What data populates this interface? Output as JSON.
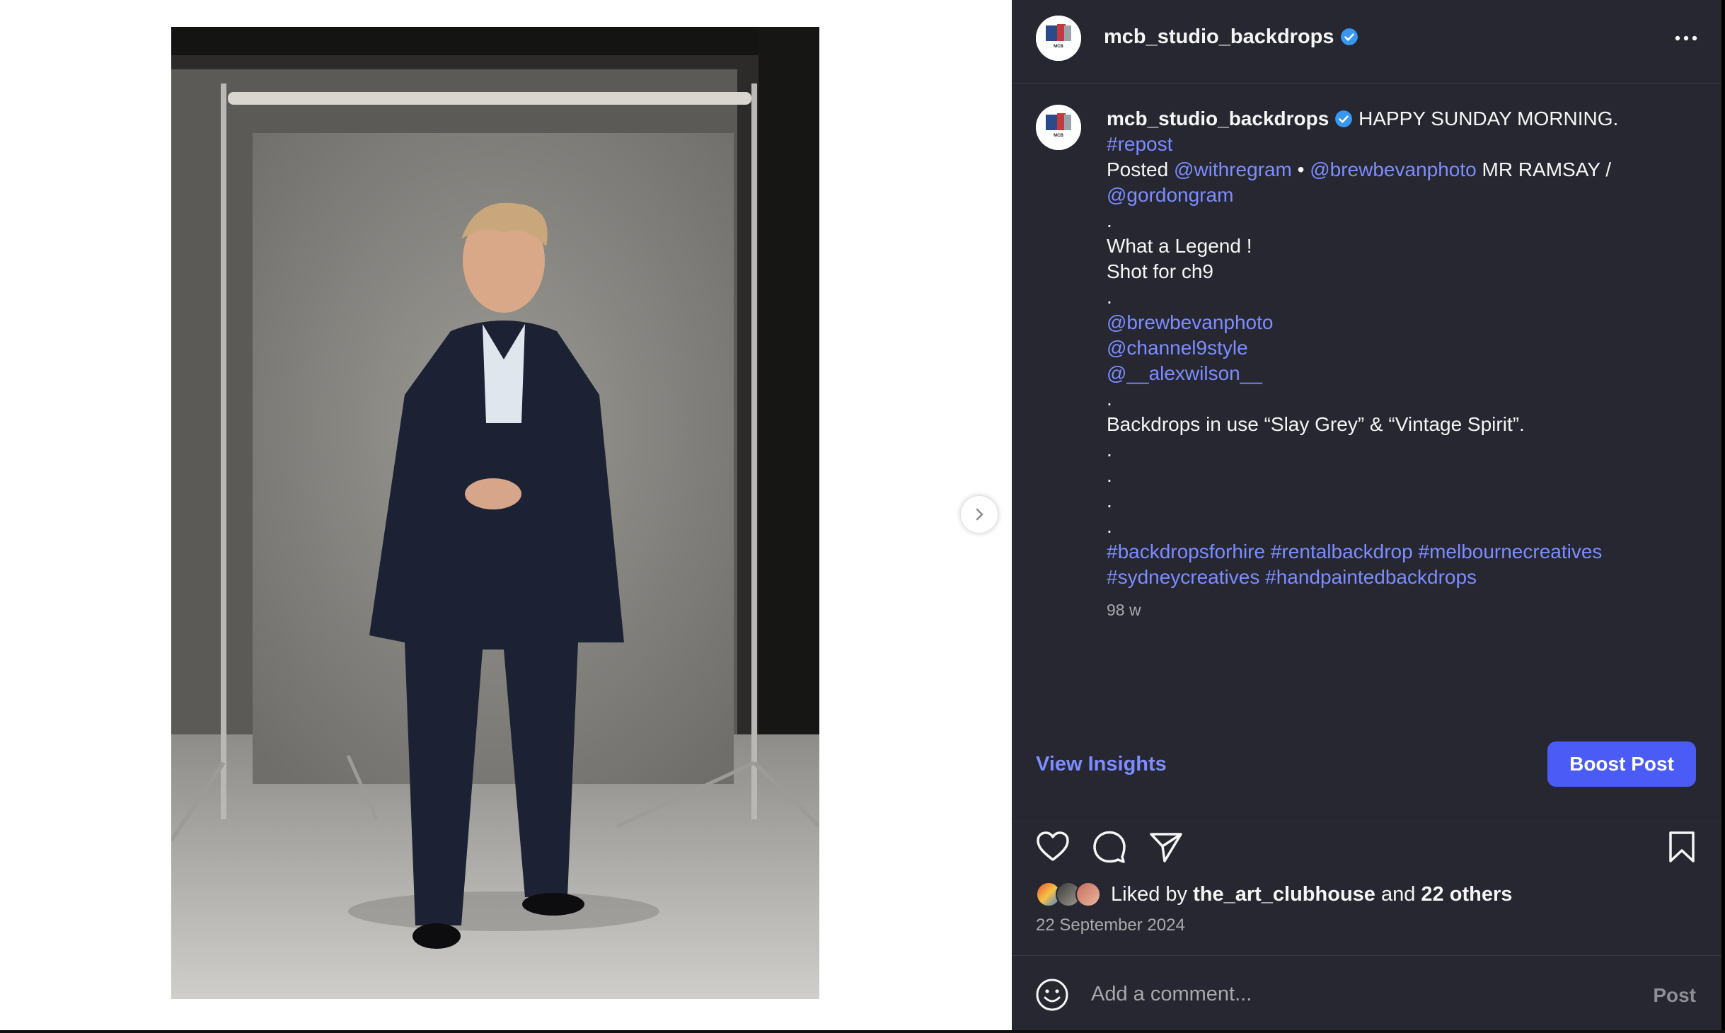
{
  "post": {
    "username": "mcb_studio_backdrops",
    "avatar_label": "MCB",
    "photo_alt": "Man in a dark checked suit standing in front of a grey painted studio backdrop",
    "caption_lines": [
      {
        "parts": [
          {
            "t": "HAPPY SUNDAY MORNING.",
            "link": false
          }
        ]
      },
      {
        "parts": [
          {
            "t": "#repost",
            "link": true
          }
        ]
      },
      {
        "parts": [
          {
            "t": "Posted ",
            "link": false
          },
          {
            "t": "@withregram",
            "link": true
          },
          {
            "t": " • ",
            "link": false
          },
          {
            "t": "@brewbevanphoto",
            "link": true
          },
          {
            "t": " MR RAMSAY /",
            "link": false
          }
        ]
      },
      {
        "parts": [
          {
            "t": "@gordongram",
            "link": true
          }
        ]
      },
      {
        "parts": [
          {
            "t": ".",
            "link": false
          }
        ]
      },
      {
        "parts": [
          {
            "t": "What a Legend !",
            "link": false
          }
        ]
      },
      {
        "parts": [
          {
            "t": "Shot for ch9",
            "link": false
          }
        ]
      },
      {
        "parts": [
          {
            "t": ".",
            "link": false
          }
        ]
      },
      {
        "parts": [
          {
            "t": "@brewbevanphoto",
            "link": true
          }
        ]
      },
      {
        "parts": [
          {
            "t": "@channel9style",
            "link": true
          }
        ]
      },
      {
        "parts": [
          {
            "t": "@__alexwilson__",
            "link": true
          }
        ]
      },
      {
        "parts": [
          {
            "t": ".",
            "link": false
          }
        ]
      },
      {
        "parts": [
          {
            "t": "Backdrops in use “Slay Grey” & “Vintage Spirit”.",
            "link": false
          }
        ]
      },
      {
        "parts": [
          {
            "t": ".",
            "link": false
          }
        ]
      },
      {
        "parts": [
          {
            "t": ".",
            "link": false
          }
        ]
      },
      {
        "parts": [
          {
            "t": ".",
            "link": false
          }
        ]
      },
      {
        "parts": [
          {
            "t": ".",
            "link": false
          }
        ]
      },
      {
        "parts": [
          {
            "t": "#backdropsforhire",
            "link": true
          },
          {
            "t": " ",
            "link": false
          },
          {
            "t": "#rentalbackdrop",
            "link": true
          },
          {
            "t": " ",
            "link": false
          },
          {
            "t": "#melbournecreatives",
            "link": true
          }
        ]
      },
      {
        "parts": [
          {
            "t": "#sydneycreatives",
            "link": true
          },
          {
            "t": " ",
            "link": false
          },
          {
            "t": "#handpaintedbackdrops",
            "link": true
          }
        ]
      }
    ],
    "time_ago": "98 w",
    "view_insights_label": "View Insights",
    "boost_label": "Boost Post",
    "liked_by_prefix": "Liked by ",
    "liked_by_user": "the_art_clubhouse",
    "liked_by_and": " and ",
    "liked_by_others": "22 others",
    "date": "22 September 2024",
    "comment_placeholder": "Add a comment...",
    "post_label": "Post"
  },
  "icons": {
    "verified": "verified-badge-icon",
    "more": "more-options-icon",
    "next": "chevron-right-icon",
    "like": "heart-icon",
    "comment": "comment-bubble-icon",
    "share": "paper-plane-icon",
    "save": "bookmark-icon",
    "emoji": "smiley-icon"
  },
  "colors": {
    "panel_bg": "#262730",
    "link": "#7d8cff",
    "boost_button": "#4a5bf6",
    "verified_badge": "#3897f0",
    "muted_text": "#a8a8ad"
  }
}
